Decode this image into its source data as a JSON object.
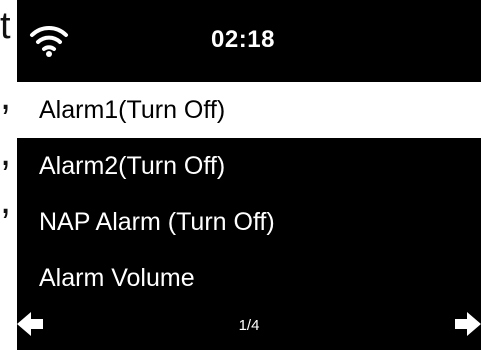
{
  "background": {
    "fragments": [
      "t",
      ",",
      ",",
      ","
    ]
  },
  "status_bar": {
    "wifi_icon": "wifi-icon",
    "time": "02:18"
  },
  "menu": {
    "items": [
      {
        "label": "Alarm1(Turn Off)",
        "selected": true
      },
      {
        "label": "Alarm2(Turn Off)",
        "selected": false
      },
      {
        "label": "NAP Alarm (Turn Off)",
        "selected": false
      },
      {
        "label": "Alarm Volume",
        "selected": false
      }
    ]
  },
  "footer": {
    "page_indicator": "1/4",
    "left_icon": "arrow-left-icon",
    "right_icon": "arrow-right-icon"
  },
  "colors": {
    "screen_background": "#000000",
    "selected_background": "#ffffff",
    "text": "#ffffff",
    "selected_text": "#000000"
  }
}
